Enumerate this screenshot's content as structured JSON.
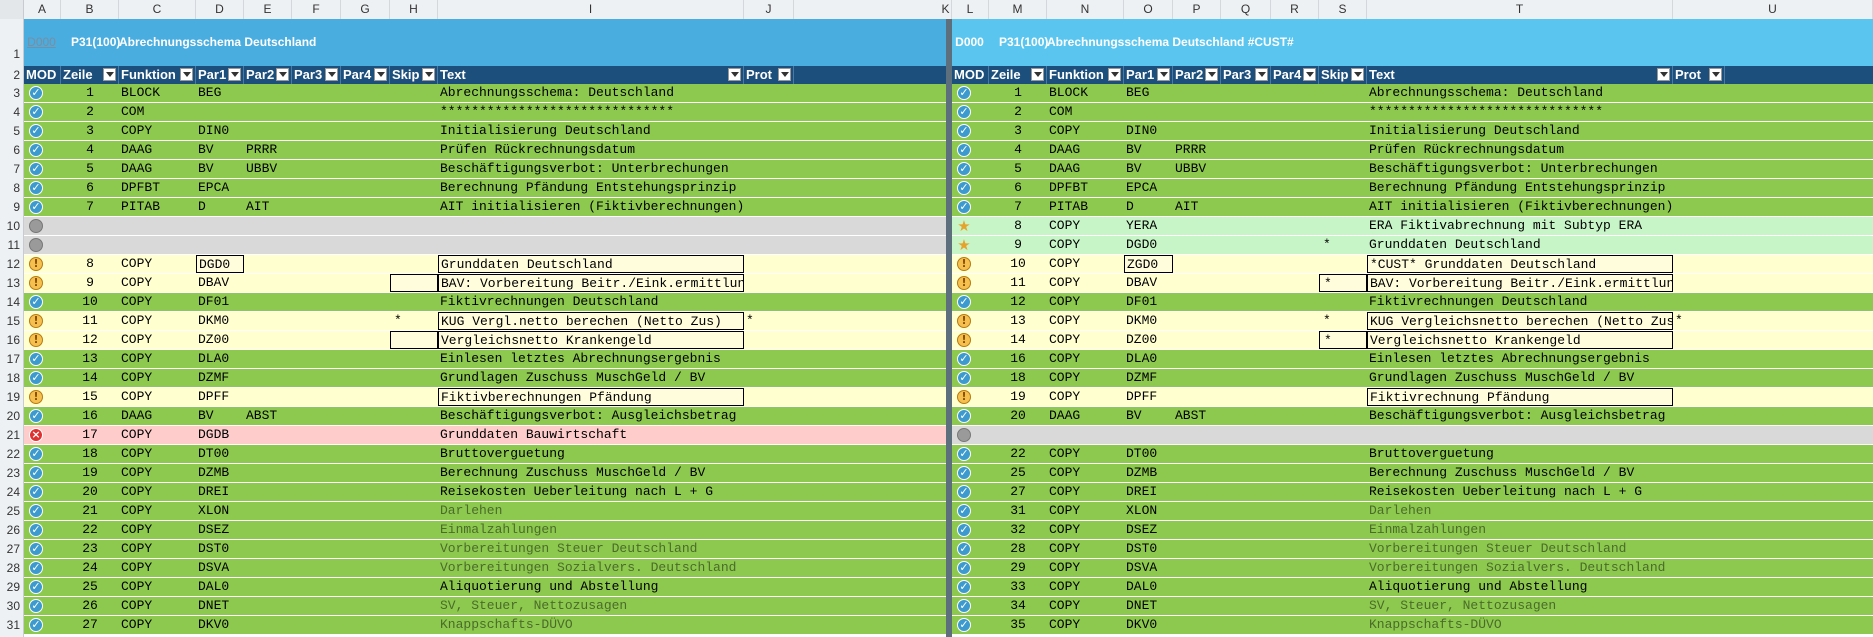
{
  "columns": {
    "left": [
      "A",
      "B",
      "C",
      "D",
      "E",
      "F",
      "G",
      "H",
      "I",
      "J"
    ],
    "right": [
      "K",
      "L",
      "M",
      "N",
      "O",
      "P",
      "Q",
      "R",
      "S",
      "T",
      "U"
    ]
  },
  "row_numbers": [
    "1",
    "2",
    "3",
    "4",
    "5",
    "6",
    "7",
    "8",
    "9",
    "10",
    "11",
    "12",
    "13",
    "14",
    "15",
    "16",
    "17",
    "18",
    "19",
    "20",
    "21",
    "22",
    "23",
    "24",
    "25",
    "26",
    "27",
    "28",
    "29",
    "30",
    "31"
  ],
  "left": {
    "title": {
      "code": "D000",
      "version": "P31(100)",
      "name": "Abrechnungsschema Deutschland"
    },
    "headers": [
      "MOD",
      "Zeile",
      "Funktion",
      "Par1",
      "Par2",
      "Par3",
      "Par4",
      "Skip",
      "Text",
      "Prot"
    ],
    "rows": [
      {
        "st": "ok",
        "z": "1",
        "f": "BLOCK",
        "p1": "BEG",
        "p2": "",
        "skip": "",
        "text": "Abrechnungsschema: Deutschland",
        "prot": ""
      },
      {
        "st": "ok",
        "z": "2",
        "f": "COM",
        "p1": "",
        "p2": "",
        "skip": "",
        "text": "******************************",
        "prot": ""
      },
      {
        "st": "ok",
        "z": "3",
        "f": "COPY",
        "p1": "DIN0",
        "p2": "",
        "skip": "",
        "text": "Initialisierung Deutschland",
        "prot": ""
      },
      {
        "st": "ok",
        "z": "4",
        "f": "DAAG",
        "p1": "BV",
        "p2": "PRRR",
        "skip": "",
        "text": "Prüfen Rückrechnungsdatum",
        "prot": ""
      },
      {
        "st": "ok",
        "z": "5",
        "f": "DAAG",
        "p1": "BV",
        "p2": "UBBV",
        "skip": "",
        "text": "Beschäftigungsverbot: Unterbrechungen",
        "prot": ""
      },
      {
        "st": "ok",
        "z": "6",
        "f": "DPFBT",
        "p1": "EPCA",
        "p2": "",
        "skip": "",
        "text": "Berechnung Pfändung Entstehungsprinzip",
        "prot": ""
      },
      {
        "st": "ok",
        "z": "7",
        "f": "PITAB",
        "p1": "D",
        "p2": "AIT",
        "skip": "",
        "text": "AIT initialisieren  (Fiktivberechnungen)",
        "prot": ""
      },
      {
        "st": "gray",
        "z": "",
        "f": "",
        "p1": "",
        "p2": "",
        "skip": "",
        "text": "",
        "prot": ""
      },
      {
        "st": "gray",
        "z": "",
        "f": "",
        "p1": "",
        "p2": "",
        "skip": "",
        "text": "",
        "prot": ""
      },
      {
        "st": "warn",
        "z": "8",
        "f": "COPY",
        "p1": "DGD0",
        "p2": "",
        "skip": "",
        "text": "Grunddaten Deutschland",
        "prot": ""
      },
      {
        "st": "warn",
        "z": "9",
        "f": "COPY",
        "p1": "DBAV",
        "p2": "",
        "skip": "",
        "text": "BAV: Vorbereitung Beitr./Eink.ermittlung",
        "prot": ""
      },
      {
        "st": "ok",
        "z": "10",
        "f": "COPY",
        "p1": "DF01",
        "p2": "",
        "skip": "",
        "text": "Fiktivrechnungen Deutschland",
        "prot": ""
      },
      {
        "st": "warn",
        "z": "11",
        "f": "COPY",
        "p1": "DKM0",
        "p2": "",
        "skip": "*",
        "text": "KUG Vergl.netto berechen (Netto Zus)",
        "prot": "*"
      },
      {
        "st": "warn",
        "z": "12",
        "f": "COPY",
        "p1": "DZ00",
        "p2": "",
        "skip": "",
        "text": "Vergleichsnetto Krankengeld",
        "prot": ""
      },
      {
        "st": "ok",
        "z": "13",
        "f": "COPY",
        "p1": "DLA0",
        "p2": "",
        "skip": "",
        "text": "Einlesen letztes Abrechnungsergebnis",
        "prot": ""
      },
      {
        "st": "ok",
        "z": "14",
        "f": "COPY",
        "p1": "DZMF",
        "p2": "",
        "skip": "",
        "text": "Grundlagen Zuschuss MuschGeld / BV",
        "prot": ""
      },
      {
        "st": "warn",
        "z": "15",
        "f": "COPY",
        "p1": "DPFF",
        "p2": "",
        "skip": "",
        "text": "Fiktivberechnungen Pfändung",
        "prot": ""
      },
      {
        "st": "ok",
        "z": "16",
        "f": "DAAG",
        "p1": "BV",
        "p2": "ABST",
        "skip": "",
        "text": "Beschäftigungsverbot: Ausgleichsbetrag",
        "prot": ""
      },
      {
        "st": "err",
        "z": "17",
        "f": "COPY",
        "p1": "DGDB",
        "p2": "",
        "skip": "",
        "text": "Grunddaten Bauwirtschaft",
        "prot": ""
      },
      {
        "st": "ok",
        "z": "18",
        "f": "COPY",
        "p1": "DT00",
        "p2": "",
        "skip": "",
        "text": "Bruttoverguetung",
        "prot": ""
      },
      {
        "st": "ok",
        "z": "19",
        "f": "COPY",
        "p1": "DZMB",
        "p2": "",
        "skip": "",
        "text": "Berechnung Zuschuss MuschGeld / BV",
        "prot": ""
      },
      {
        "st": "ok",
        "z": "20",
        "f": "COPY",
        "p1": "DREI",
        "p2": "",
        "skip": "",
        "text": "Reisekosten Ueberleitung nach L + G",
        "prot": ""
      },
      {
        "st": "ok",
        "z": "21",
        "f": "COPY",
        "p1": "XLON",
        "p2": "",
        "skip": "",
        "text": "Darlehen",
        "prot": ""
      },
      {
        "st": "ok",
        "z": "22",
        "f": "COPY",
        "p1": "DSEZ",
        "p2": "",
        "skip": "",
        "text": "Einmalzahlungen",
        "prot": ""
      },
      {
        "st": "ok",
        "z": "23",
        "f": "COPY",
        "p1": "DST0",
        "p2": "",
        "skip": "",
        "text": "Vorbereitungen Steuer Deutschland",
        "prot": ""
      },
      {
        "st": "ok",
        "z": "24",
        "f": "COPY",
        "p1": "DSVA",
        "p2": "",
        "skip": "",
        "text": "Vorbereitungen Sozialvers. Deutschland",
        "prot": ""
      },
      {
        "st": "ok",
        "z": "25",
        "f": "COPY",
        "p1": "DAL0",
        "p2": "",
        "skip": "",
        "text": "Aliquotierung und Abstellung",
        "prot": ""
      },
      {
        "st": "ok",
        "z": "26",
        "f": "COPY",
        "p1": "DNET",
        "p2": "",
        "skip": "",
        "text": "SV, Steuer, Nettozusagen",
        "prot": ""
      },
      {
        "st": "ok",
        "z": "27",
        "f": "COPY",
        "p1": "DKV0",
        "p2": "",
        "skip": "",
        "text": "Knappschafts-DÜVO",
        "prot": ""
      }
    ]
  },
  "right": {
    "title": {
      "code": "D000",
      "version": "P31(100)",
      "name": "Abrechnungsschema Deutschland #CUST#"
    },
    "headers": [
      "MOD",
      "Zeile",
      "Funktion",
      "Par1",
      "Par2",
      "Par3",
      "Par4",
      "Skip",
      "Text",
      "Prot"
    ],
    "rows": [
      {
        "st": "ok",
        "z": "1",
        "f": "BLOCK",
        "p1": "BEG",
        "p2": "",
        "skip": "",
        "text": "Abrechnungsschema: Deutschland",
        "prot": ""
      },
      {
        "st": "ok",
        "z": "2",
        "f": "COM",
        "p1": "",
        "p2": "",
        "skip": "",
        "text": "******************************",
        "prot": ""
      },
      {
        "st": "ok",
        "z": "3",
        "f": "COPY",
        "p1": "DIN0",
        "p2": "",
        "skip": "",
        "text": "Initialisierung Deutschland",
        "prot": ""
      },
      {
        "st": "ok",
        "z": "4",
        "f": "DAAG",
        "p1": "BV",
        "p2": "PRRR",
        "skip": "",
        "text": "Prüfen Rückrechnungsdatum",
        "prot": ""
      },
      {
        "st": "ok",
        "z": "5",
        "f": "DAAG",
        "p1": "BV",
        "p2": "UBBV",
        "skip": "",
        "text": "Beschäftigungsverbot: Unterbrechungen",
        "prot": ""
      },
      {
        "st": "ok",
        "z": "6",
        "f": "DPFBT",
        "p1": "EPCA",
        "p2": "",
        "skip": "",
        "text": "Berechnung Pfändung Entstehungsprinzip",
        "prot": ""
      },
      {
        "st": "ok",
        "z": "7",
        "f": "PITAB",
        "p1": "D",
        "p2": "AIT",
        "skip": "",
        "text": "AIT initialisieren  (Fiktivberechnungen)",
        "prot": ""
      },
      {
        "st": "star",
        "z": "8",
        "f": "COPY",
        "p1": "YERA",
        "p2": "",
        "skip": "",
        "text": "ERA Fiktivabrechnung mit Subtyp ERA",
        "prot": ""
      },
      {
        "st": "star",
        "z": "9",
        "f": "COPY",
        "p1": "DGD0",
        "p2": "",
        "skip": "*",
        "text": "Grunddaten Deutschland",
        "prot": ""
      },
      {
        "st": "warn",
        "z": "10",
        "f": "COPY",
        "p1": "ZGD0",
        "p2": "",
        "skip": "",
        "text": "*CUST* Grunddaten Deutschland",
        "prot": ""
      },
      {
        "st": "warn",
        "z": "11",
        "f": "COPY",
        "p1": "DBAV",
        "p2": "",
        "skip": "*",
        "text": "BAV: Vorbereitung Beitr./Eink.ermittlung",
        "prot": ""
      },
      {
        "st": "ok",
        "z": "12",
        "f": "COPY",
        "p1": "DF01",
        "p2": "",
        "skip": "",
        "text": "Fiktivrechnungen Deutschland",
        "prot": ""
      },
      {
        "st": "warn",
        "z": "13",
        "f": "COPY",
        "p1": "DKM0",
        "p2": "",
        "skip": "*",
        "text": "KUG Vergleichsnetto berechen (Netto Zus)",
        "prot": "*"
      },
      {
        "st": "warn",
        "z": "14",
        "f": "COPY",
        "p1": "DZ00",
        "p2": "",
        "skip": "*",
        "text": "Vergleichsnetto Krankengeld",
        "prot": ""
      },
      {
        "st": "ok",
        "z": "16",
        "f": "COPY",
        "p1": "DLA0",
        "p2": "",
        "skip": "",
        "text": "Einlesen letztes Abrechnungsergebnis",
        "prot": ""
      },
      {
        "st": "ok",
        "z": "18",
        "f": "COPY",
        "p1": "DZMF",
        "p2": "",
        "skip": "",
        "text": "Grundlagen Zuschuss MuschGeld / BV",
        "prot": ""
      },
      {
        "st": "warn",
        "z": "19",
        "f": "COPY",
        "p1": "DPFF",
        "p2": "",
        "skip": "",
        "text": "Fiktivrechnung Pfändung",
        "prot": ""
      },
      {
        "st": "ok",
        "z": "20",
        "f": "DAAG",
        "p1": "BV",
        "p2": "ABST",
        "skip": "",
        "text": "Beschäftigungsverbot: Ausgleichsbetrag",
        "prot": ""
      },
      {
        "st": "gray",
        "z": "",
        "f": "",
        "p1": "",
        "p2": "",
        "skip": "",
        "text": "",
        "prot": ""
      },
      {
        "st": "ok",
        "z": "22",
        "f": "COPY",
        "p1": "DT00",
        "p2": "",
        "skip": "",
        "text": "Bruttoverguetung",
        "prot": ""
      },
      {
        "st": "ok",
        "z": "25",
        "f": "COPY",
        "p1": "DZMB",
        "p2": "",
        "skip": "",
        "text": "Berechnung Zuschuss MuschGeld / BV",
        "prot": ""
      },
      {
        "st": "ok",
        "z": "27",
        "f": "COPY",
        "p1": "DREI",
        "p2": "",
        "skip": "",
        "text": "Reisekosten Ueberleitung nach L + G",
        "prot": ""
      },
      {
        "st": "ok",
        "z": "31",
        "f": "COPY",
        "p1": "XLON",
        "p2": "",
        "skip": "",
        "text": "Darlehen",
        "prot": ""
      },
      {
        "st": "ok",
        "z": "32",
        "f": "COPY",
        "p1": "DSEZ",
        "p2": "",
        "skip": "",
        "text": "Einmalzahlungen",
        "prot": ""
      },
      {
        "st": "ok",
        "z": "28",
        "f": "COPY",
        "p1": "DST0",
        "p2": "",
        "skip": "",
        "text": "Vorbereitungen Steuer Deutschland",
        "prot": ""
      },
      {
        "st": "ok",
        "z": "29",
        "f": "COPY",
        "p1": "DSVA",
        "p2": "",
        "skip": "",
        "text": "Vorbereitungen Sozialvers. Deutschland",
        "prot": ""
      },
      {
        "st": "ok",
        "z": "33",
        "f": "COPY",
        "p1": "DAL0",
        "p2": "",
        "skip": "",
        "text": "Aliquotierung und Abstellung",
        "prot": ""
      },
      {
        "st": "ok",
        "z": "34",
        "f": "COPY",
        "p1": "DNET",
        "p2": "",
        "skip": "",
        "text": "SV, Steuer, Nettozusagen",
        "prot": ""
      },
      {
        "st": "ok",
        "z": "35",
        "f": "COPY",
        "p1": "DKV0",
        "p2": "",
        "skip": "",
        "text": "Knappschafts-DÜVO",
        "prot": ""
      }
    ]
  },
  "colors": {
    "ok_row": "#8dc94f",
    "gray_row": "#d9d9d9",
    "warn_row": "#ffffd0",
    "err_row": "#ffcccc",
    "new_row": "#c8f5c8",
    "header_bg": "#1c4f7c",
    "title_bg_left": "#49ade0",
    "title_bg_right": "#5ac6f0",
    "muted_text": "#4a6b2a"
  },
  "icons": {
    "ok": "check-circle-icon",
    "gray": "gray-circle-icon",
    "warn": "exclamation-circle-icon",
    "err": "x-circle-icon",
    "star": "star-icon"
  }
}
